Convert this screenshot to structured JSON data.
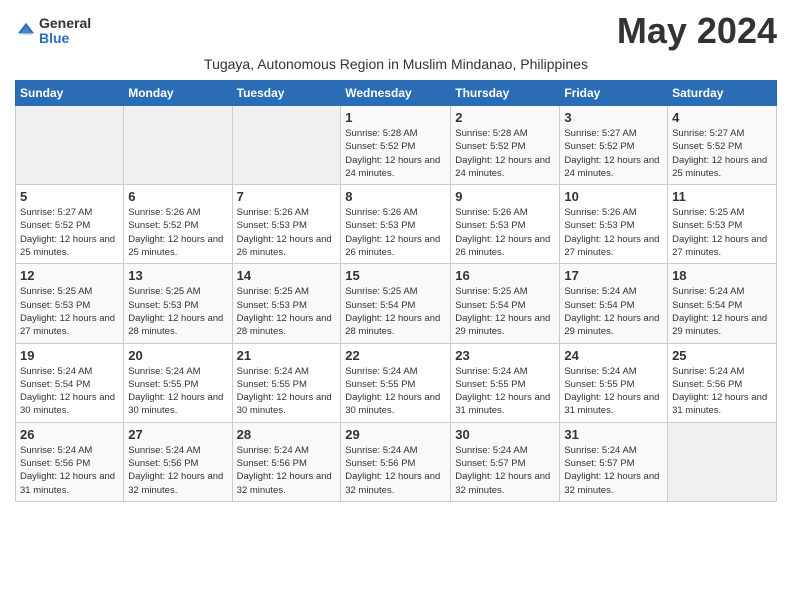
{
  "header": {
    "logo_general": "General",
    "logo_blue": "Blue",
    "month_title": "May 2024",
    "subtitle": "Tugaya, Autonomous Region in Muslim Mindanao, Philippines"
  },
  "weekdays": [
    "Sunday",
    "Monday",
    "Tuesday",
    "Wednesday",
    "Thursday",
    "Friday",
    "Saturday"
  ],
  "weeks": [
    [
      {
        "day": "",
        "info": ""
      },
      {
        "day": "",
        "info": ""
      },
      {
        "day": "",
        "info": ""
      },
      {
        "day": "1",
        "info": "Sunrise: 5:28 AM\nSunset: 5:52 PM\nDaylight: 12 hours\nand 24 minutes."
      },
      {
        "day": "2",
        "info": "Sunrise: 5:28 AM\nSunset: 5:52 PM\nDaylight: 12 hours\nand 24 minutes."
      },
      {
        "day": "3",
        "info": "Sunrise: 5:27 AM\nSunset: 5:52 PM\nDaylight: 12 hours\nand 24 minutes."
      },
      {
        "day": "4",
        "info": "Sunrise: 5:27 AM\nSunset: 5:52 PM\nDaylight: 12 hours\nand 25 minutes."
      }
    ],
    [
      {
        "day": "5",
        "info": "Sunrise: 5:27 AM\nSunset: 5:52 PM\nDaylight: 12 hours\nand 25 minutes."
      },
      {
        "day": "6",
        "info": "Sunrise: 5:26 AM\nSunset: 5:52 PM\nDaylight: 12 hours\nand 25 minutes."
      },
      {
        "day": "7",
        "info": "Sunrise: 5:26 AM\nSunset: 5:53 PM\nDaylight: 12 hours\nand 26 minutes."
      },
      {
        "day": "8",
        "info": "Sunrise: 5:26 AM\nSunset: 5:53 PM\nDaylight: 12 hours\nand 26 minutes."
      },
      {
        "day": "9",
        "info": "Sunrise: 5:26 AM\nSunset: 5:53 PM\nDaylight: 12 hours\nand 26 minutes."
      },
      {
        "day": "10",
        "info": "Sunrise: 5:26 AM\nSunset: 5:53 PM\nDaylight: 12 hours\nand 27 minutes."
      },
      {
        "day": "11",
        "info": "Sunrise: 5:25 AM\nSunset: 5:53 PM\nDaylight: 12 hours\nand 27 minutes."
      }
    ],
    [
      {
        "day": "12",
        "info": "Sunrise: 5:25 AM\nSunset: 5:53 PM\nDaylight: 12 hours\nand 27 minutes."
      },
      {
        "day": "13",
        "info": "Sunrise: 5:25 AM\nSunset: 5:53 PM\nDaylight: 12 hours\nand 28 minutes."
      },
      {
        "day": "14",
        "info": "Sunrise: 5:25 AM\nSunset: 5:53 PM\nDaylight: 12 hours\nand 28 minutes."
      },
      {
        "day": "15",
        "info": "Sunrise: 5:25 AM\nSunset: 5:54 PM\nDaylight: 12 hours\nand 28 minutes."
      },
      {
        "day": "16",
        "info": "Sunrise: 5:25 AM\nSunset: 5:54 PM\nDaylight: 12 hours\nand 29 minutes."
      },
      {
        "day": "17",
        "info": "Sunrise: 5:24 AM\nSunset: 5:54 PM\nDaylight: 12 hours\nand 29 minutes."
      },
      {
        "day": "18",
        "info": "Sunrise: 5:24 AM\nSunset: 5:54 PM\nDaylight: 12 hours\nand 29 minutes."
      }
    ],
    [
      {
        "day": "19",
        "info": "Sunrise: 5:24 AM\nSunset: 5:54 PM\nDaylight: 12 hours\nand 30 minutes."
      },
      {
        "day": "20",
        "info": "Sunrise: 5:24 AM\nSunset: 5:55 PM\nDaylight: 12 hours\nand 30 minutes."
      },
      {
        "day": "21",
        "info": "Sunrise: 5:24 AM\nSunset: 5:55 PM\nDaylight: 12 hours\nand 30 minutes."
      },
      {
        "day": "22",
        "info": "Sunrise: 5:24 AM\nSunset: 5:55 PM\nDaylight: 12 hours\nand 30 minutes."
      },
      {
        "day": "23",
        "info": "Sunrise: 5:24 AM\nSunset: 5:55 PM\nDaylight: 12 hours\nand 31 minutes."
      },
      {
        "day": "24",
        "info": "Sunrise: 5:24 AM\nSunset: 5:55 PM\nDaylight: 12 hours\nand 31 minutes."
      },
      {
        "day": "25",
        "info": "Sunrise: 5:24 AM\nSunset: 5:56 PM\nDaylight: 12 hours\nand 31 minutes."
      }
    ],
    [
      {
        "day": "26",
        "info": "Sunrise: 5:24 AM\nSunset: 5:56 PM\nDaylight: 12 hours\nand 31 minutes."
      },
      {
        "day": "27",
        "info": "Sunrise: 5:24 AM\nSunset: 5:56 PM\nDaylight: 12 hours\nand 32 minutes."
      },
      {
        "day": "28",
        "info": "Sunrise: 5:24 AM\nSunset: 5:56 PM\nDaylight: 12 hours\nand 32 minutes."
      },
      {
        "day": "29",
        "info": "Sunrise: 5:24 AM\nSunset: 5:56 PM\nDaylight: 12 hours\nand 32 minutes."
      },
      {
        "day": "30",
        "info": "Sunrise: 5:24 AM\nSunset: 5:57 PM\nDaylight: 12 hours\nand 32 minutes."
      },
      {
        "day": "31",
        "info": "Sunrise: 5:24 AM\nSunset: 5:57 PM\nDaylight: 12 hours\nand 32 minutes."
      },
      {
        "day": "",
        "info": ""
      }
    ]
  ]
}
